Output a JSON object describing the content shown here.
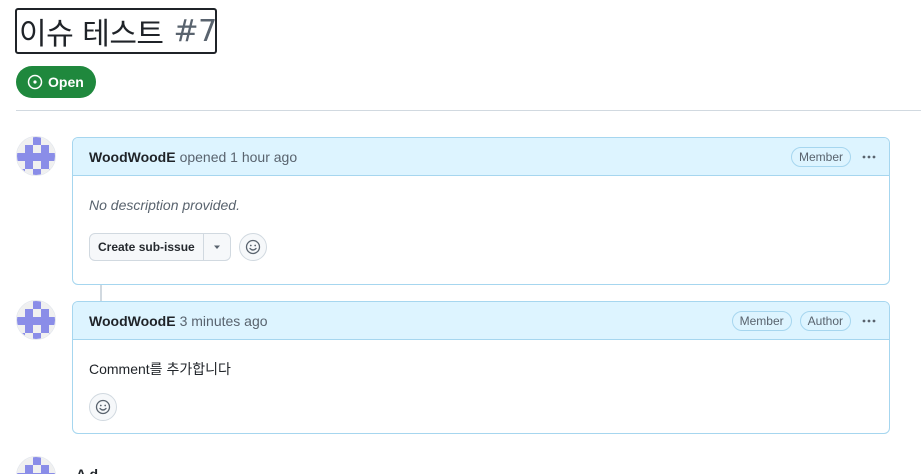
{
  "issue": {
    "title": "이슈 테스트",
    "number": "#7",
    "state": "Open"
  },
  "comments": [
    {
      "author": "WoodWoodE",
      "meta": "opened 1 hour ago",
      "labels": [
        "Member"
      ],
      "body": "No description provided.",
      "actions": {
        "create_sub_issue": "Create sub-issue"
      }
    },
    {
      "author": "WoodWoodE",
      "meta": "3 minutes ago",
      "labels": [
        "Member",
        "Author"
      ],
      "body": "Comment를 추가합니다"
    }
  ],
  "next_author_partial": "A d",
  "icons": {
    "state": "issue-opened-icon",
    "kebab": "kebab-horizontal-icon",
    "caret": "triangle-down-icon",
    "reaction": "smiley-icon"
  },
  "colors": {
    "open_green": "#1f883d",
    "header_blue": "#ddf4ff",
    "border_blue": "#a6d6ef",
    "avatar_purple": "#8a8de8"
  }
}
